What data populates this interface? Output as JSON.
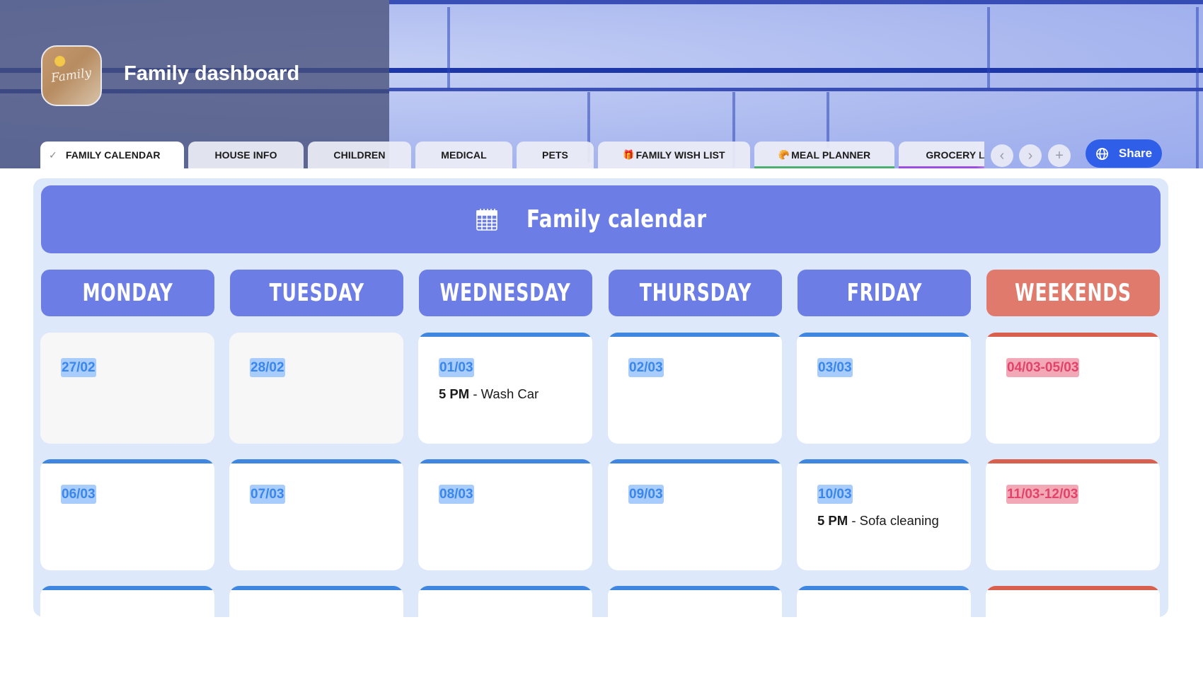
{
  "header": {
    "title": "Family dashboard",
    "logo_text": "Family"
  },
  "tabs": [
    {
      "label": "FAMILY CALENDAR",
      "active": true,
      "icon": "check-icon"
    },
    {
      "label": "HOUSE INFO"
    },
    {
      "label": "CHILDREN"
    },
    {
      "label": "MEDICAL"
    },
    {
      "label": "PETS"
    },
    {
      "label": "FAMILY WISH LIST",
      "emoji": "🎁"
    },
    {
      "label": "MEAL PLANNER",
      "emoji": "🥐",
      "underline_color": "#4caf72"
    },
    {
      "label": "GROCERY L",
      "underline_color": "#9b4fe0"
    }
  ],
  "tab_nav": {
    "prev": "‹",
    "next": "›",
    "add": "+"
  },
  "share": {
    "label": "Share",
    "icon": "globe-icon"
  },
  "calendar": {
    "title": "Family calendar",
    "colors": {
      "accent": "#6c7ee6",
      "weekend": "#e07a6c",
      "weekday_bar": "#3f86e0",
      "weekend_bar": "#d9604f",
      "board": "#dde8fa"
    },
    "days": [
      "MONDAY",
      "TUESDAY",
      "WEDNESDAY",
      "THURSDAY",
      "FRIDAY",
      "WEEKENDS"
    ],
    "weeks": [
      [
        {
          "date": "27/02",
          "past": true
        },
        {
          "date": "28/02",
          "past": true
        },
        {
          "date": "01/03",
          "event_time": "5 PM",
          "event_text": " - Wash Car"
        },
        {
          "date": "02/03"
        },
        {
          "date": "03/03"
        },
        {
          "date": "04/03-05/03",
          "weekend": true
        }
      ],
      [
        {
          "date": "06/03"
        },
        {
          "date": "07/03"
        },
        {
          "date": "08/03"
        },
        {
          "date": "09/03"
        },
        {
          "date": "10/03",
          "event_time": "5 PM",
          "event_text": " - Sofa cleaning"
        },
        {
          "date": "11/03-12/03",
          "weekend": true
        }
      ]
    ]
  }
}
